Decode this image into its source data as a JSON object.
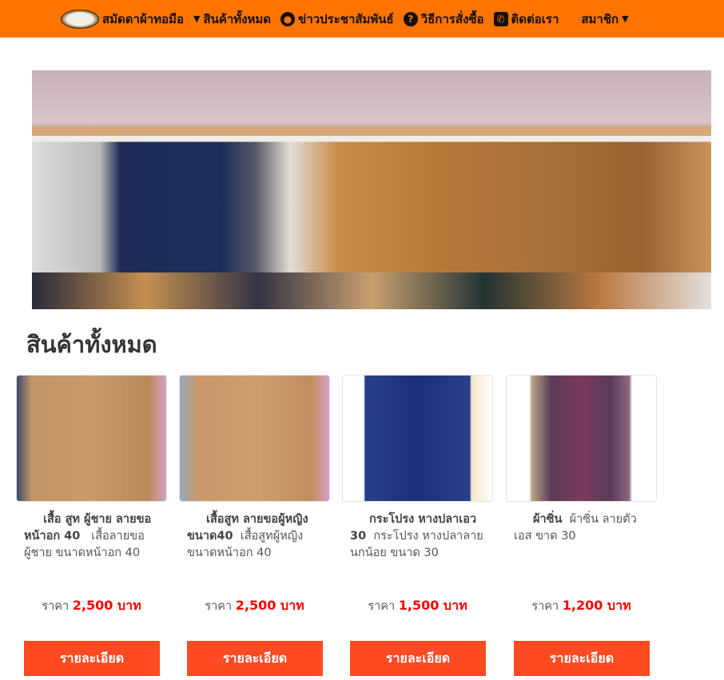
{
  "nav": {
    "brand": "สมัดดาผ้าทอมือ",
    "items": [
      {
        "label": "สินค้าทั้งหมด",
        "icon": "caret-down"
      },
      {
        "label": "ข่าวประชาสัมพันธ์",
        "icon": "comments"
      },
      {
        "label": "วิธีการสั่งซื้อ",
        "icon": "question-circle"
      },
      {
        "label": "ติดต่อเรา",
        "icon": "phone-square"
      },
      {
        "label": "สมาชิก",
        "icon": "caret-down"
      }
    ]
  },
  "section_title": "สินค้าทั้งหมด",
  "products": [
    {
      "title": "เสื้อ สูท ผู้ชาย ลายขอ หน้าอก 40",
      "detail": "เสื้อลายขอ ผู้ชาย ขนาดหน้าอก 40",
      "price_label": "ราคา",
      "price": "2,500 บาท",
      "button": "รายละเอียด"
    },
    {
      "title": "เสื้อสูท ลายขอผู้หญิง ขนาด40",
      "detail": "เสื้อสูทผู้หญิง ขนาดหน้าอก 40",
      "price_label": "ราคา",
      "price": "2,500 บาท",
      "button": "รายละเอียด"
    },
    {
      "title": "กระโปรง หางปลาเอว 30",
      "detail": "กระโปรง หางปลาลายนกน้อย ขนาด 30",
      "price_label": "ราคา",
      "price": "1,500 บาท",
      "button": "รายละเอียด"
    },
    {
      "title": "ผ้าซิ่น",
      "detail": "ผ้าซิ่น ลายตัวเอส ขาด 30",
      "price_label": "ราคา",
      "price": "1,200 บาท",
      "button": "รายละเอียด"
    }
  ],
  "colors": {
    "nav": "#ff7300",
    "button": "#ff4a22",
    "price": "#ff0000"
  }
}
